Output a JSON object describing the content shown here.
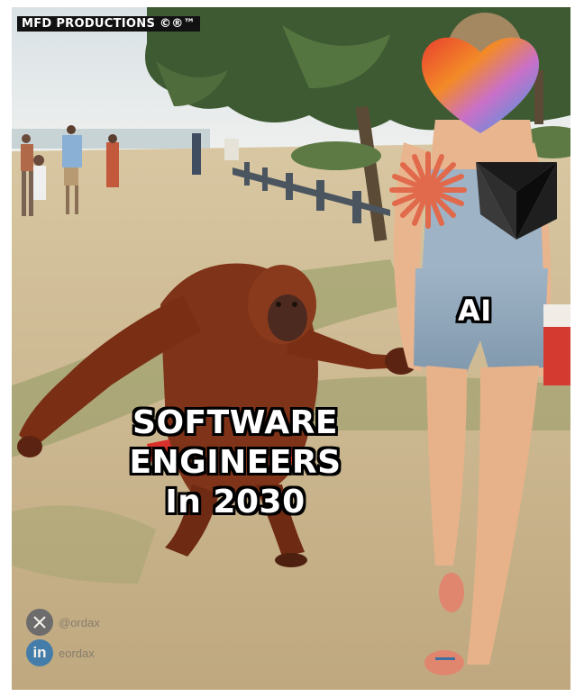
{
  "watermark": {
    "text": "MFD PRODUCTIONS",
    "marks": "©®™"
  },
  "captions": {
    "main": [
      "SOFTWARE",
      "ENGINEERS",
      "In 2030"
    ],
    "ai": "AI"
  },
  "handles": {
    "x": {
      "icon": "x-logo-icon",
      "text": "@ordax"
    },
    "linkedin": {
      "icon": "linkedin-logo-icon",
      "badge": "in",
      "text": "eordax"
    }
  },
  "colors": {
    "sand": "#cdbb94",
    "sky": "#dfe6ea",
    "orangutan": "#7a2e14",
    "caption_fill": "#ffffff",
    "caption_stroke": "#000000"
  }
}
